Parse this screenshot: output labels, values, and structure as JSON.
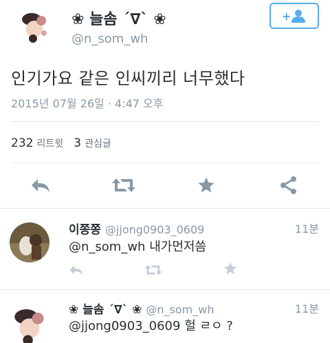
{
  "tweet": {
    "display_name": "❀ 늘솜 ´∇` ❀",
    "screen_name": "@n_som_wh",
    "text": "인기가요 같은 인씨끼리 너무했다",
    "timestamp": "2015년 07월 26일 · 4:47 오후",
    "retweet_count": "232",
    "retweet_label": "리트윗",
    "favorite_count": "3",
    "favorite_label": "관심글",
    "follow_icon": "follow-person-plus-icon"
  },
  "actions": [
    "reply-icon",
    "retweet-icon",
    "favorite-star-icon",
    "share-icon"
  ],
  "replies": [
    {
      "name": "이쫑쫑",
      "handle": "@jjong0903_0609",
      "time": "11분",
      "mention": "@n_som_wh",
      "body": "내가먼저씀"
    },
    {
      "name": "❀ 늘솜 ´∇` ❀",
      "handle": "@n_som_wh",
      "time": "11분",
      "mention": "@jjong0903_0609",
      "body": "헐 ㄹㅇ ?"
    }
  ],
  "colors": {
    "accent": "#55acee",
    "icon": "#8899a6",
    "text": "#292f33",
    "muted": "#8899a6",
    "divider": "#e1e8ed"
  }
}
